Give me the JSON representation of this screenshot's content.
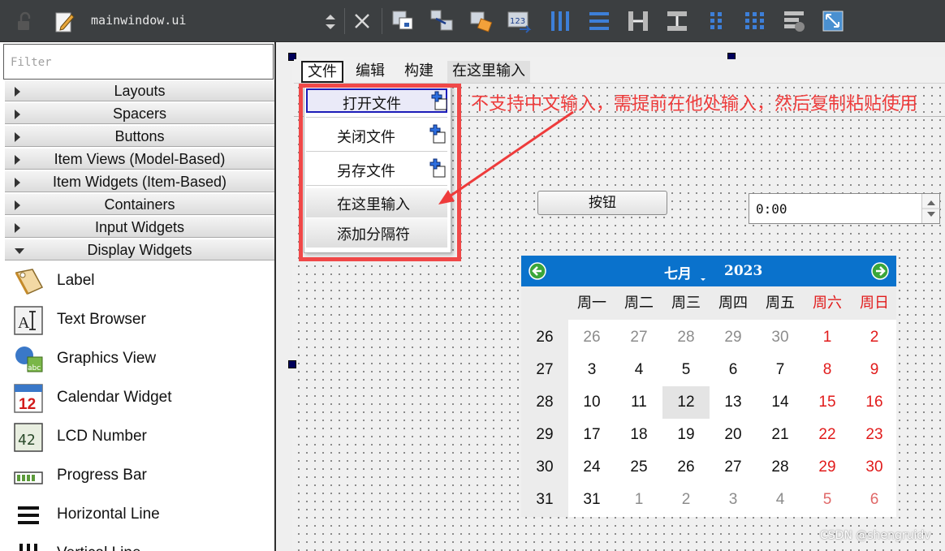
{
  "toolbar": {
    "filename": "mainwindow.ui",
    "tools": [
      {
        "icon": "delete-icon"
      },
      {
        "icon": "edit-widgets-icon"
      },
      {
        "icon": "edit-signals-slots-icon"
      },
      {
        "icon": "edit-buddies-icon"
      },
      {
        "icon": "edit-tab-order-icon"
      },
      {
        "icon": "layout-horizontal-icon"
      },
      {
        "icon": "layout-vertical-icon"
      },
      {
        "icon": "layout-horizontal-splitter-icon"
      },
      {
        "icon": "layout-vertical-splitter-icon"
      },
      {
        "icon": "layout-form-icon"
      },
      {
        "icon": "layout-grid-icon"
      },
      {
        "icon": "break-layout-icon"
      },
      {
        "icon": "adjust-size-icon"
      }
    ]
  },
  "widget_box": {
    "filter_placeholder": "Filter",
    "categories": [
      {
        "label": "Layouts",
        "expanded": false
      },
      {
        "label": "Spacers",
        "expanded": false
      },
      {
        "label": "Buttons",
        "expanded": false
      },
      {
        "label": "Item Views (Model-Based)",
        "expanded": false
      },
      {
        "label": "Item Widgets (Item-Based)",
        "expanded": false
      },
      {
        "label": "Containers",
        "expanded": false
      },
      {
        "label": "Input Widgets",
        "expanded": false
      },
      {
        "label": "Display Widgets",
        "expanded": true
      }
    ],
    "display_widgets": [
      {
        "label": "Label",
        "icon": "label-icon"
      },
      {
        "label": "Text Browser",
        "icon": "text-browser-icon"
      },
      {
        "label": "Graphics View",
        "icon": "graphics-view-icon"
      },
      {
        "label": "Calendar Widget",
        "icon": "calendar-icon",
        "icon_text": "12"
      },
      {
        "label": "LCD Number",
        "icon": "lcd-number-icon",
        "icon_text": "42"
      },
      {
        "label": "Progress Bar",
        "icon": "progress-bar-icon"
      },
      {
        "label": "Horizontal Line",
        "icon": "horizontal-line-icon"
      },
      {
        "label": "Vertical Line",
        "icon": "vertical-line-icon"
      }
    ]
  },
  "form": {
    "menubar": {
      "menus": [
        "文件",
        "编辑",
        "构建"
      ],
      "type_here": "在这里输入"
    },
    "dropdown": {
      "items": [
        "打开文件",
        "关闭文件",
        "另存文件"
      ],
      "type_here": "在这里输入",
      "add_separator": "添加分隔符"
    },
    "annotation": "不支持中文输入，需提前在他处输入，然后复制粘贴使用",
    "push_button": "按钮",
    "time_edit": "0:00",
    "calendar": {
      "month": "七月",
      "year": "2023",
      "weekdays": [
        "周一",
        "周二",
        "周三",
        "周四",
        "周五",
        "周六",
        "周日"
      ],
      "weeks": [
        {
          "num": "26",
          "days": [
            "26",
            "27",
            "28",
            "29",
            "30",
            "1",
            "2"
          ]
        },
        {
          "num": "27",
          "days": [
            "3",
            "4",
            "5",
            "6",
            "7",
            "8",
            "9"
          ]
        },
        {
          "num": "28",
          "days": [
            "10",
            "11",
            "12",
            "13",
            "14",
            "15",
            "16"
          ]
        },
        {
          "num": "29",
          "days": [
            "17",
            "18",
            "19",
            "20",
            "21",
            "22",
            "23"
          ]
        },
        {
          "num": "30",
          "days": [
            "24",
            "25",
            "26",
            "27",
            "28",
            "29",
            "30"
          ]
        },
        {
          "num": "31",
          "days": [
            "31",
            "1",
            "2",
            "3",
            "4",
            "5",
            "6"
          ]
        }
      ],
      "selected_day": "12",
      "colors": {
        "header": "#0a72cc",
        "weekend": "#e11b1b"
      }
    }
  },
  "watermark": "CSDN @shengruidv"
}
